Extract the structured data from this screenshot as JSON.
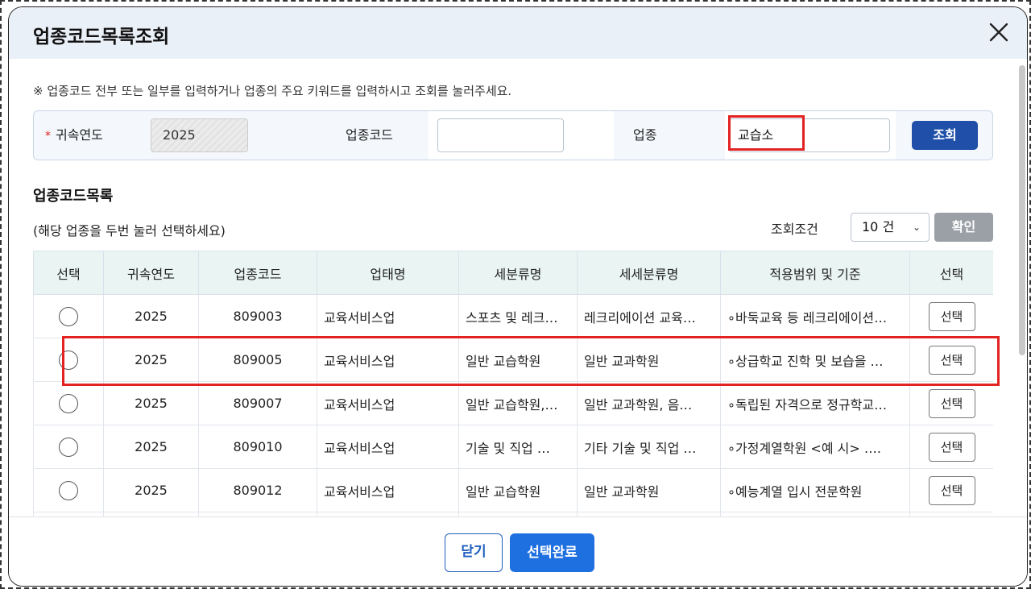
{
  "dialog": {
    "title": "업종코드목록조회",
    "notice": "※ 업종코드 전부 또는 일부를 입력하거나 업종의 주요 키워드를 입력하시고 조회를 눌러주세요."
  },
  "search": {
    "required_mark": "*",
    "year_label": "귀속연도",
    "year_value": "2025",
    "code_label": "업종코드",
    "code_value": "",
    "industry_label": "업종",
    "industry_value": "교습소",
    "search_button": "조회"
  },
  "list": {
    "title": "업종코드목록",
    "hint": "(해당 업종을 두번 눌러 선택하세요)",
    "condition_label": "조회조건",
    "condition_value": "10 건",
    "confirm_button": "확인",
    "columns": [
      "선택",
      "귀속연도",
      "업종코드",
      "업태명",
      "세분류명",
      "세세분류명",
      "적용범위 및 기준",
      "선택"
    ],
    "rows": [
      {
        "year": "2025",
        "code": "809003",
        "business": "교육서비스업",
        "sub": "스포츠 및 레크…",
        "subsub": "레크리에이션 교육…",
        "scope": "∘바둑교육 등 레크리에이션…",
        "btn": "선택"
      },
      {
        "year": "2025",
        "code": "809005",
        "business": "교육서비스업",
        "sub": "일반 교습학원",
        "subsub": "일반 교과학원",
        "scope": "∘상급학교 진학 및 보습을 …",
        "btn": "선택"
      },
      {
        "year": "2025",
        "code": "809007",
        "business": "교육서비스업",
        "sub": "일반 교습학원,…",
        "subsub": "일반 교과학원, 음…",
        "scope": "∘독립된 자격으로 정규학교…",
        "btn": "선택"
      },
      {
        "year": "2025",
        "code": "809010",
        "business": "교육서비스업",
        "sub": "기술 및 직업 …",
        "subsub": "기타 기술 및 직업 …",
        "scope": "∘가정계열학원 <예 시> ….",
        "btn": "선택"
      },
      {
        "year": "2025",
        "code": "809012",
        "business": "교육서비스업",
        "sub": "일반 교습학원",
        "subsub": "일반 교과학원",
        "scope": "∘예능계열 입시 전문학원",
        "btn": "선택"
      }
    ]
  },
  "footer": {
    "close_button": "닫기",
    "done_button": "선택완료"
  },
  "colors": {
    "header_bg": "#eaf0f7",
    "primary": "#1e6fe0",
    "search_btn": "#1f4fa8",
    "highlight": "#e32222",
    "table_header_bg": "#eaf5f3"
  },
  "icons": {
    "close": "close-icon",
    "dropdown": "chevron-down-icon"
  }
}
